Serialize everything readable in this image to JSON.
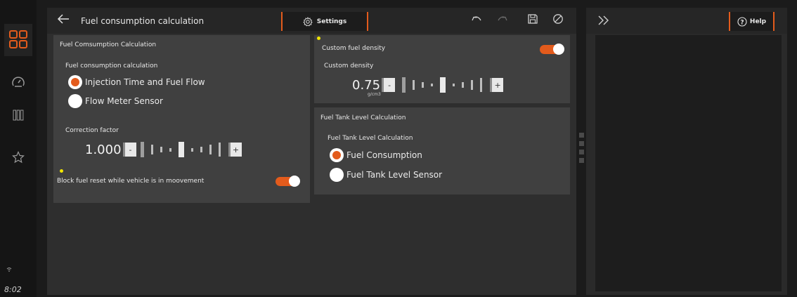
{
  "header": {
    "title": "Fuel consumption calculation",
    "settings_label": "Settings"
  },
  "status": {
    "time": "8:02"
  },
  "fuel_card": {
    "title": "Fuel Comsumption Calculation",
    "group_label": "Fuel consumption calculation",
    "options": [
      "Injection Time and Fuel Flow",
      "Flow Meter Sensor"
    ],
    "selected_option": "Injection Time and Fuel Flow",
    "correction_label": "Correction factor",
    "correction_value": "1.000",
    "minus": "-",
    "plus": "+",
    "block_reset_label": "Block fuel reset while vehicle is in moovement",
    "block_reset_on": true
  },
  "density_card": {
    "custom_fuel_density_label": "Custom fuel density",
    "custom_fuel_density_on": true,
    "custom_density_label": "Custom density",
    "density_value": "0.75",
    "density_unit": "g/cm3",
    "minus": "-",
    "plus": "+"
  },
  "tank_card": {
    "title": "Fuel Tank Level Calculation",
    "group_label": "Fuel Tank Level Calculation",
    "options": [
      "Fuel Consumption",
      "Fuel Tank Level Sensor"
    ],
    "selected_option": "Fuel Consumption"
  },
  "right_panel": {
    "help_label": "Help"
  },
  "colors": {
    "accent": "#e35b1c",
    "indicator": "#f2e600",
    "card": "#404040",
    "background": "#2e2e2e"
  },
  "icons": [
    "apps-icon",
    "gauge-icon",
    "columns-icon",
    "star-icon",
    "back-arrow-icon",
    "gear-icon",
    "undo-icon",
    "redo-icon",
    "save-icon",
    "cancel-icon",
    "expand-icon",
    "help-icon",
    "wifi-icon"
  ]
}
